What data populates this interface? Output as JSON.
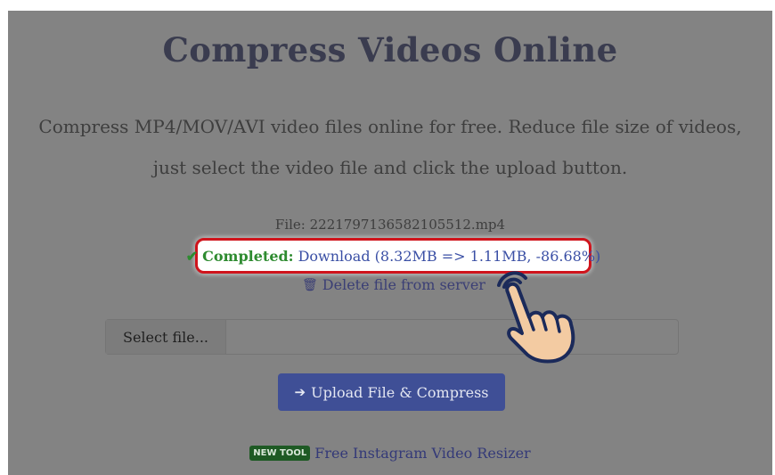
{
  "page": {
    "title": "Compress Videos Online",
    "description_line1": "Compress MP4/MOV/AVI video files online for free. Reduce file size of videos,",
    "description_line2": "just select the video file and click the upload button."
  },
  "result": {
    "file_label": "File: 2221797136582105512.mp4",
    "check_icon": "✔",
    "completed_label": "Completed:",
    "download_text": "Download (8.32MB => 1.11MB, -86.68%)",
    "trash_icon": "🗑",
    "delete_text": "Delete file from server"
  },
  "form": {
    "select_label": "Select file...",
    "select_value": "",
    "upload_icon": "➔",
    "upload_label": "Upload File & Compress"
  },
  "footer": {
    "badge": "NEW TOOL",
    "link_text": "Free Instagram Video Resizer"
  },
  "colors": {
    "completed": "#2e8b30",
    "link": "#3a4fa5",
    "highlight_border": "#d0141c",
    "upload_button": "#3f4f96",
    "badge": "#1e5a24"
  }
}
